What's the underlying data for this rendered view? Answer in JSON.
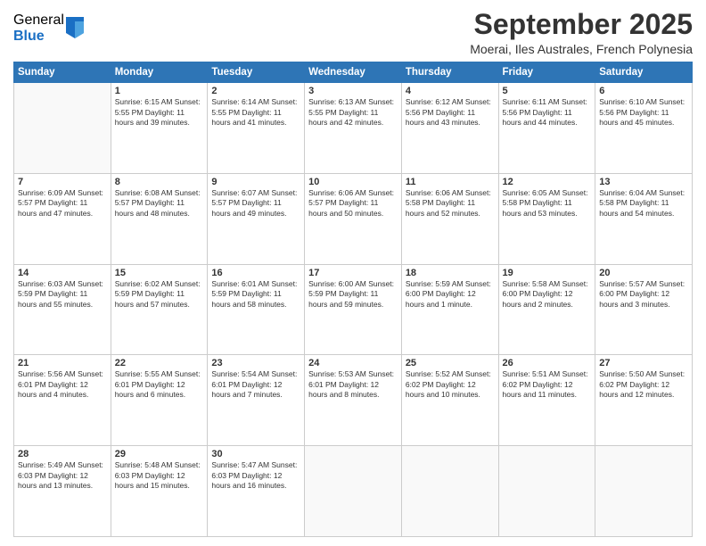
{
  "logo": {
    "general": "General",
    "blue": "Blue"
  },
  "header": {
    "month": "September 2025",
    "location": "Moerai, Iles Australes, French Polynesia"
  },
  "days_of_week": [
    "Sunday",
    "Monday",
    "Tuesday",
    "Wednesday",
    "Thursday",
    "Friday",
    "Saturday"
  ],
  "weeks": [
    [
      {
        "day": "",
        "info": ""
      },
      {
        "day": "1",
        "info": "Sunrise: 6:15 AM\nSunset: 5:55 PM\nDaylight: 11 hours\nand 39 minutes."
      },
      {
        "day": "2",
        "info": "Sunrise: 6:14 AM\nSunset: 5:55 PM\nDaylight: 11 hours\nand 41 minutes."
      },
      {
        "day": "3",
        "info": "Sunrise: 6:13 AM\nSunset: 5:55 PM\nDaylight: 11 hours\nand 42 minutes."
      },
      {
        "day": "4",
        "info": "Sunrise: 6:12 AM\nSunset: 5:56 PM\nDaylight: 11 hours\nand 43 minutes."
      },
      {
        "day": "5",
        "info": "Sunrise: 6:11 AM\nSunset: 5:56 PM\nDaylight: 11 hours\nand 44 minutes."
      },
      {
        "day": "6",
        "info": "Sunrise: 6:10 AM\nSunset: 5:56 PM\nDaylight: 11 hours\nand 45 minutes."
      }
    ],
    [
      {
        "day": "7",
        "info": "Sunrise: 6:09 AM\nSunset: 5:57 PM\nDaylight: 11 hours\nand 47 minutes."
      },
      {
        "day": "8",
        "info": "Sunrise: 6:08 AM\nSunset: 5:57 PM\nDaylight: 11 hours\nand 48 minutes."
      },
      {
        "day": "9",
        "info": "Sunrise: 6:07 AM\nSunset: 5:57 PM\nDaylight: 11 hours\nand 49 minutes."
      },
      {
        "day": "10",
        "info": "Sunrise: 6:06 AM\nSunset: 5:57 PM\nDaylight: 11 hours\nand 50 minutes."
      },
      {
        "day": "11",
        "info": "Sunrise: 6:06 AM\nSunset: 5:58 PM\nDaylight: 11 hours\nand 52 minutes."
      },
      {
        "day": "12",
        "info": "Sunrise: 6:05 AM\nSunset: 5:58 PM\nDaylight: 11 hours\nand 53 minutes."
      },
      {
        "day": "13",
        "info": "Sunrise: 6:04 AM\nSunset: 5:58 PM\nDaylight: 11 hours\nand 54 minutes."
      }
    ],
    [
      {
        "day": "14",
        "info": "Sunrise: 6:03 AM\nSunset: 5:59 PM\nDaylight: 11 hours\nand 55 minutes."
      },
      {
        "day": "15",
        "info": "Sunrise: 6:02 AM\nSunset: 5:59 PM\nDaylight: 11 hours\nand 57 minutes."
      },
      {
        "day": "16",
        "info": "Sunrise: 6:01 AM\nSunset: 5:59 PM\nDaylight: 11 hours\nand 58 minutes."
      },
      {
        "day": "17",
        "info": "Sunrise: 6:00 AM\nSunset: 5:59 PM\nDaylight: 11 hours\nand 59 minutes."
      },
      {
        "day": "18",
        "info": "Sunrise: 5:59 AM\nSunset: 6:00 PM\nDaylight: 12 hours\nand 1 minute."
      },
      {
        "day": "19",
        "info": "Sunrise: 5:58 AM\nSunset: 6:00 PM\nDaylight: 12 hours\nand 2 minutes."
      },
      {
        "day": "20",
        "info": "Sunrise: 5:57 AM\nSunset: 6:00 PM\nDaylight: 12 hours\nand 3 minutes."
      }
    ],
    [
      {
        "day": "21",
        "info": "Sunrise: 5:56 AM\nSunset: 6:01 PM\nDaylight: 12 hours\nand 4 minutes."
      },
      {
        "day": "22",
        "info": "Sunrise: 5:55 AM\nSunset: 6:01 PM\nDaylight: 12 hours\nand 6 minutes."
      },
      {
        "day": "23",
        "info": "Sunrise: 5:54 AM\nSunset: 6:01 PM\nDaylight: 12 hours\nand 7 minutes."
      },
      {
        "day": "24",
        "info": "Sunrise: 5:53 AM\nSunset: 6:01 PM\nDaylight: 12 hours\nand 8 minutes."
      },
      {
        "day": "25",
        "info": "Sunrise: 5:52 AM\nSunset: 6:02 PM\nDaylight: 12 hours\nand 10 minutes."
      },
      {
        "day": "26",
        "info": "Sunrise: 5:51 AM\nSunset: 6:02 PM\nDaylight: 12 hours\nand 11 minutes."
      },
      {
        "day": "27",
        "info": "Sunrise: 5:50 AM\nSunset: 6:02 PM\nDaylight: 12 hours\nand 12 minutes."
      }
    ],
    [
      {
        "day": "28",
        "info": "Sunrise: 5:49 AM\nSunset: 6:03 PM\nDaylight: 12 hours\nand 13 minutes."
      },
      {
        "day": "29",
        "info": "Sunrise: 5:48 AM\nSunset: 6:03 PM\nDaylight: 12 hours\nand 15 minutes."
      },
      {
        "day": "30",
        "info": "Sunrise: 5:47 AM\nSunset: 6:03 PM\nDaylight: 12 hours\nand 16 minutes."
      },
      {
        "day": "",
        "info": ""
      },
      {
        "day": "",
        "info": ""
      },
      {
        "day": "",
        "info": ""
      },
      {
        "day": "",
        "info": ""
      }
    ]
  ]
}
